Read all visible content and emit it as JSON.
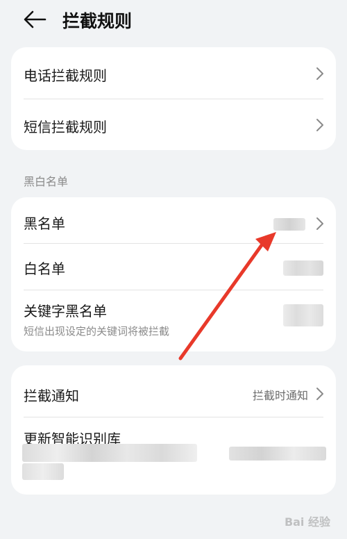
{
  "header": {
    "title": "拦截规则",
    "back_icon": "arrow-left-icon"
  },
  "rules_card": {
    "items": [
      {
        "label": "电话拦截规则"
      },
      {
        "label": "短信拦截规则"
      }
    ]
  },
  "lists_section": {
    "title": "黑白名单",
    "items": [
      {
        "label": "黑名单"
      },
      {
        "label": "白名单"
      },
      {
        "label": "关键字黑名单",
        "subtitle": "短信出现设定的关键词将被拦截"
      }
    ]
  },
  "other_card": {
    "items": [
      {
        "label": "拦截通知",
        "value": "拦截时通知"
      },
      {
        "label": "更新智能识别库"
      }
    ]
  },
  "annotation": {
    "color": "#e8392a"
  },
  "watermark": {
    "text": "Bai 经验"
  }
}
